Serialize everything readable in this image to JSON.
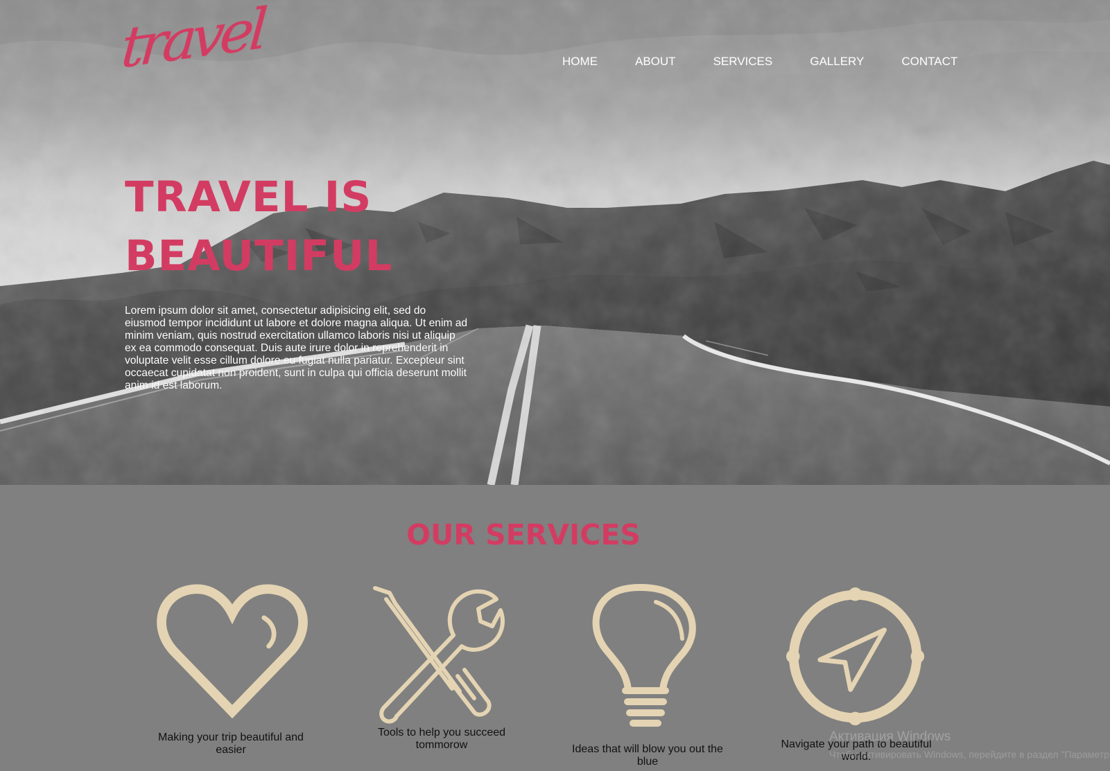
{
  "header": {
    "logo_text": "travel",
    "nav": [
      {
        "label": "HOME"
      },
      {
        "label": "ABOUT"
      },
      {
        "label": "SERVICES"
      },
      {
        "label": "GALLERY"
      },
      {
        "label": "CONTACT"
      }
    ]
  },
  "hero": {
    "title_line_1": "TRAVEL IS",
    "title_line_2": "BEAUTIFUL",
    "paragraph": "Lorem ipsum dolor sit amet, consectetur adipisicing elit, sed do eiusmod tempor incididunt ut labore et dolore magna aliqua. Ut enim ad minim veniam, quis nostrud exercitation ullamco laboris nisi ut aliquip ex ea commodo consequat. Duis aute irure dolor in reprehenderit in voluptate velit esse cillum dolore eu fugiat nulla pariatur. Excepteur sint occaecat cupidatat non proident, sunt in culpa qui officia deserunt mollit anim id est laborum."
  },
  "services": {
    "title": "OUR SERVICES",
    "items": [
      {
        "icon": "heart-icon",
        "text": "Making your trip beautiful and easier"
      },
      {
        "icon": "tools-icon",
        "text": "Tools to help you succeed tommorow"
      },
      {
        "icon": "lightbulb-icon",
        "text": "Ideas that will blow you out the blue"
      },
      {
        "icon": "compass-icon",
        "text": "Navigate your path to beautiful world."
      }
    ]
  },
  "overlay": {
    "windows_activation_title": "Активация Windows",
    "windows_activation_text": "Чтобы активировать Windows, перейдите в раздел \"Параметры\"."
  },
  "colors": {
    "accent": "#d33c62",
    "icon": "#e4d4b3",
    "page_background": "#808080",
    "hero_text": "#ffffff",
    "body_text": "#111111"
  }
}
